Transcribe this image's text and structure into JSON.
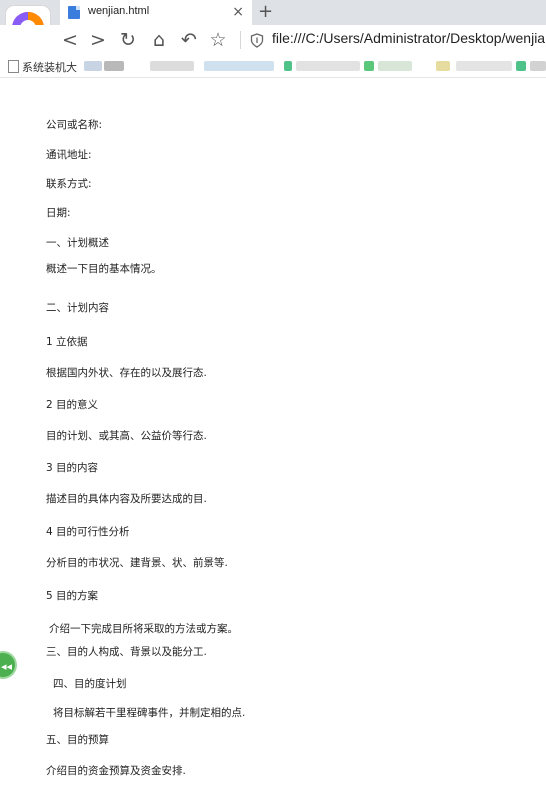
{
  "tab": {
    "title": "wenjian.html",
    "close": "×",
    "new_tab": "+"
  },
  "toolbar": {
    "back": "<",
    "forward": ">",
    "reload": "↻",
    "home": "⌂",
    "undo": "↶",
    "star": "☆",
    "url": "file:///C:/Users/Administrator/Desktop/wenjia"
  },
  "bookmarks": {
    "first_item": "系统装机大"
  },
  "document": {
    "lines": [
      "公司或名称:",
      "通讯地址:",
      "联系方式:",
      "日期:",
      "一、计划概述",
      "概述一下目的基本情况。",
      "二、计划内容",
      "1 立依据",
      "根据国内外状、存在的以及展行态.",
      "2 目的意义",
      "目的计划、或其高、公益价等行态.",
      "3 目的内容",
      "描述目的具体内容及所要达成的目.",
      "4 目的可行性分析",
      "分析目的市状况、建背景、状、前景等.",
      "5 目的方案",
      "介绍一下完成目所将采取的方法或方案。",
      "三、目的人构成、背景以及能分工.",
      "四、目的度计划",
      "将目标解若干里程碑事件，并制定相的点.",
      "五、目的预算",
      "介绍目的资金预算及资金安排."
    ]
  },
  "float_button": {
    "label": "◂◂"
  },
  "colors": {
    "tabstrip": "#dee1e6",
    "accent": "#3b7ddd",
    "float": "#4caf50"
  }
}
